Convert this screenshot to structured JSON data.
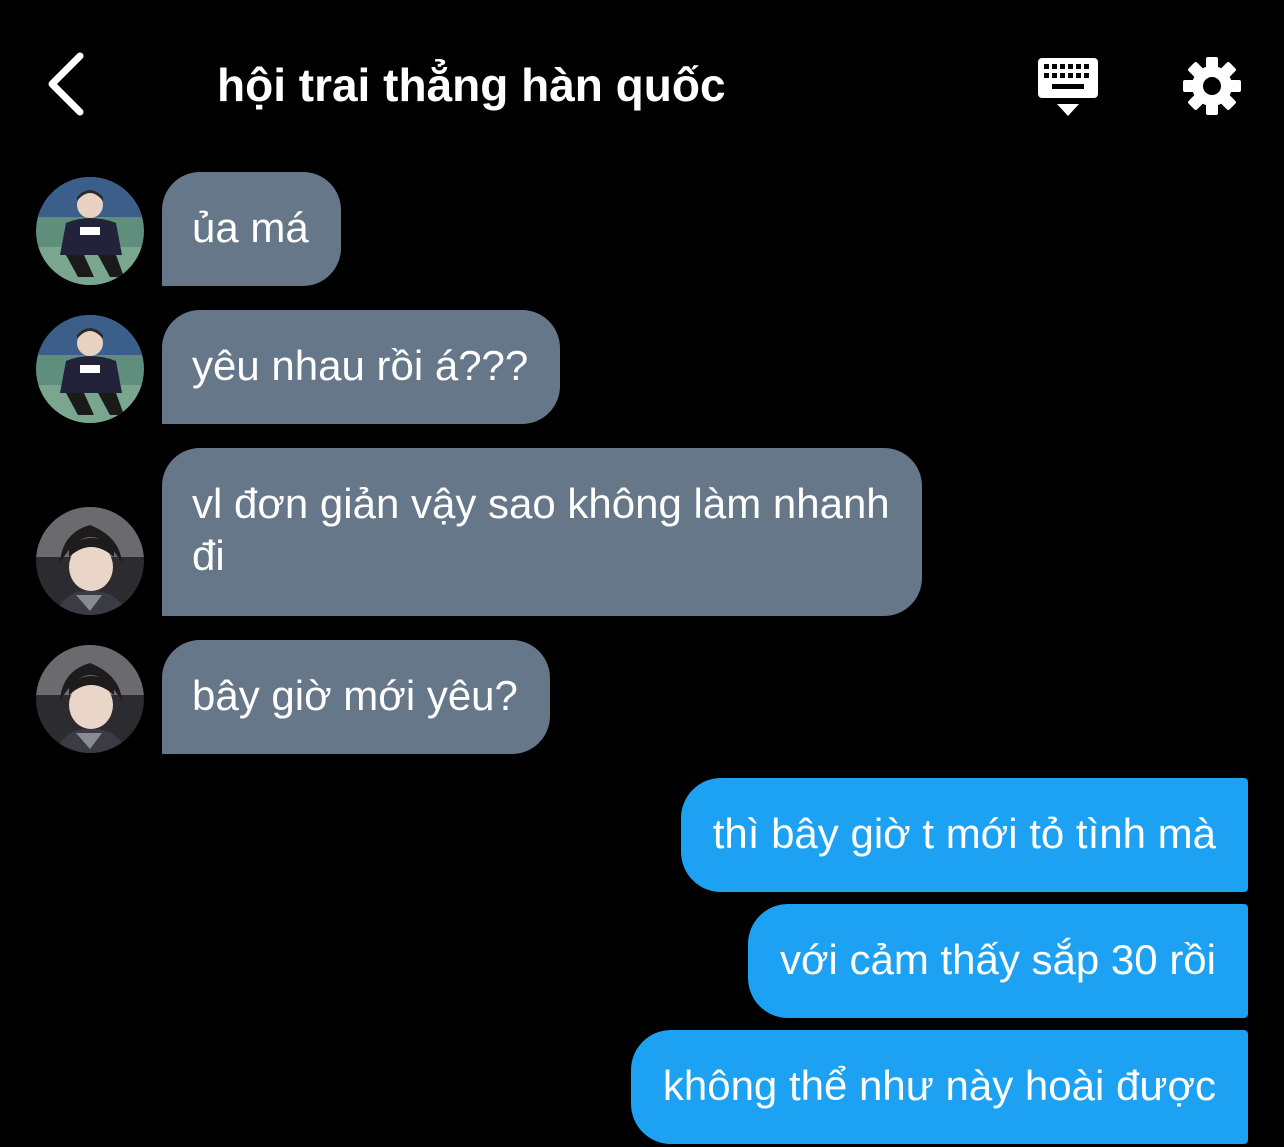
{
  "header": {
    "title": "hội trai thẳng hàn quốc",
    "back_icon": "chevron-left-icon",
    "keyboard_icon": "keyboard-icon",
    "settings_icon": "gear-icon"
  },
  "colors": {
    "background": "#000000",
    "incoming_bubble": "#66778a",
    "outgoing_bubble": "#1da1f2",
    "text": "#ffffff"
  },
  "messages": [
    {
      "side": "incoming",
      "avatar": "avatar-user-a",
      "text": "ủa má"
    },
    {
      "side": "incoming",
      "avatar": "avatar-user-a",
      "text": "yêu nhau rồi á???"
    },
    {
      "side": "incoming",
      "avatar": "avatar-user-b",
      "line1": "vl đơn giản vậy sao không làm nhanh",
      "line2": "đi"
    },
    {
      "side": "incoming",
      "avatar": "avatar-user-b",
      "text": "bây giờ mới yêu?"
    },
    {
      "side": "outgoing",
      "text": "thì bây giờ t mới tỏ tình mà"
    },
    {
      "side": "outgoing",
      "text": "với cảm thấy sắp 30 rồi"
    },
    {
      "side": "outgoing",
      "text": "không thể như này hoài được"
    }
  ]
}
